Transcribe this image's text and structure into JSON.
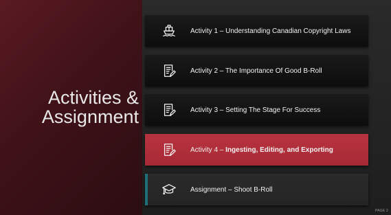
{
  "slide": {
    "title_line1": "Activities &",
    "title_line2": "Assignment",
    "page_number": "PAGE 2"
  },
  "items": [
    {
      "icon": "ship-icon",
      "label": "Activity 1 – Understanding Canadian Copyright Laws"
    },
    {
      "icon": "document-edit-icon",
      "label": "Activity 2 – The Importance Of Good B-Roll"
    },
    {
      "icon": "document-edit-icon",
      "label": "Activity 3 – Setting The Stage For Success"
    },
    {
      "icon": "document-edit-icon",
      "label_prefix": "Activity 4 – ",
      "label_bold": "Ingesting, Editing, and Exporting"
    },
    {
      "icon": "graduation-cap-icon",
      "label": "Assignment – Shoot B-Roll"
    }
  ],
  "colors": {
    "left_panel": "#4a151c",
    "active_item": "#b02f3b",
    "accent_bar": "#1f6e7a"
  }
}
